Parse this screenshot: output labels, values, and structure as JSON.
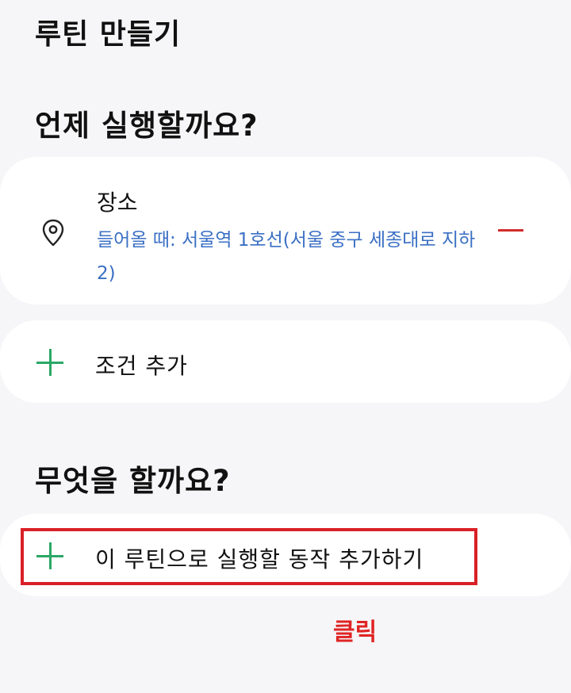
{
  "header": {
    "title": "루틴 만들기"
  },
  "when_section": {
    "heading": "언제 실행할까요?",
    "location_card": {
      "icon": "location-pin-icon",
      "title": "장소",
      "description": "들어올 때: 서울역 1호선(서울 중구 세종대로 지하 2)"
    },
    "add_condition": {
      "icon": "plus-icon",
      "label": "조건 추가"
    }
  },
  "what_section": {
    "heading": "무엇을 할까요?",
    "add_action": {
      "icon": "plus-icon",
      "label": "이 루틴으로 실행할 동작 추가하기"
    }
  },
  "annotation": {
    "click_label": "클릭",
    "color": "#e02424"
  },
  "colors": {
    "background": "#f6f6f8",
    "card": "#ffffff",
    "link_blue": "#3a6fc4",
    "plus_green": "#2aa866",
    "minus_red": "#d22b2b",
    "highlight_red": "#d92027"
  }
}
